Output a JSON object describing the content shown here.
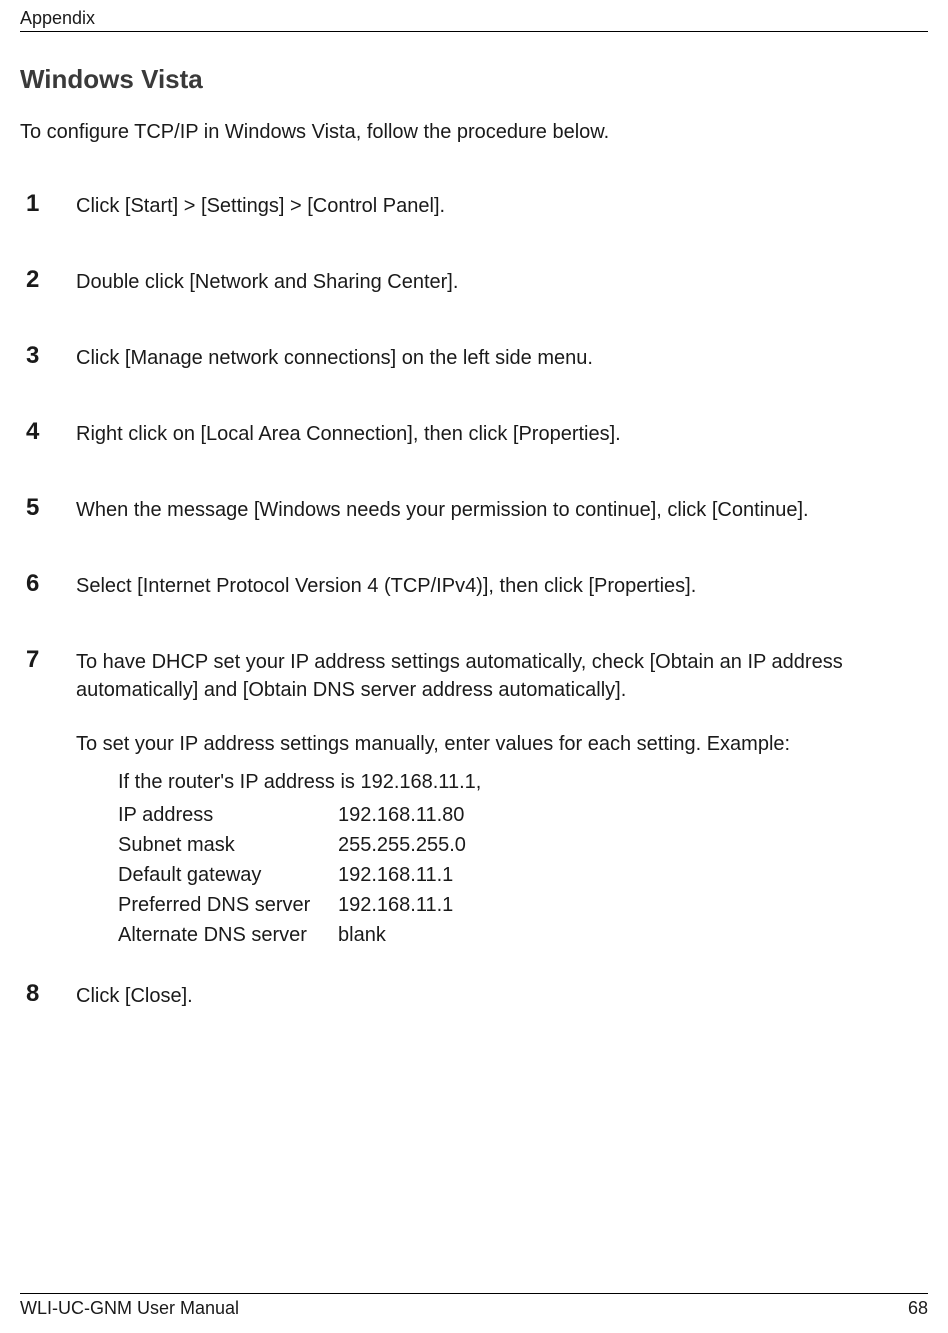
{
  "header": {
    "label": "Appendix"
  },
  "title": "Windows Vista",
  "intro": "To configure TCP/IP in Windows Vista, follow the procedure below.",
  "steps": {
    "s1": {
      "num": "1",
      "text": "Click [Start] > [Settings] > [Control Panel]."
    },
    "s2": {
      "num": "2",
      "text": "Double click [Network and Sharing Center]."
    },
    "s3": {
      "num": "3",
      "text": "Click [Manage network connections] on the left side menu."
    },
    "s4": {
      "num": "4",
      "text": "Right click on [Local Area Connection], then click [Properties]."
    },
    "s5": {
      "num": "5",
      "text": "When the message [Windows needs your permission to continue], click [Continue]."
    },
    "s6": {
      "num": "6",
      "text": "Select [Internet Protocol Version 4 (TCP/IPv4)], then click [Properties]."
    },
    "s7": {
      "num": "7",
      "text": "To have DHCP set your IP address settings automatically, check [Obtain an IP address automatically] and [Obtain DNS server address automatically].",
      "manual_intro": "To set your IP address settings manually, enter values for each setting.  Example:",
      "example_intro": "If the router's IP address is 192.168.11.1,",
      "rows": {
        "ip": {
          "label": "IP address",
          "value": "192.168.11.80"
        },
        "mask": {
          "label": "Subnet mask",
          "value": "255.255.255.0"
        },
        "gw": {
          "label": "Default gateway",
          "value": "192.168.11.1"
        },
        "pdns": {
          "label": "Preferred DNS server",
          "value": "192.168.11.1"
        },
        "adns": {
          "label": "Alternate DNS server",
          "value": "blank"
        }
      }
    },
    "s8": {
      "num": "8",
      "text": "Click [Close]."
    }
  },
  "footer": {
    "left": "WLI-UC-GNM User Manual",
    "right": "68"
  }
}
